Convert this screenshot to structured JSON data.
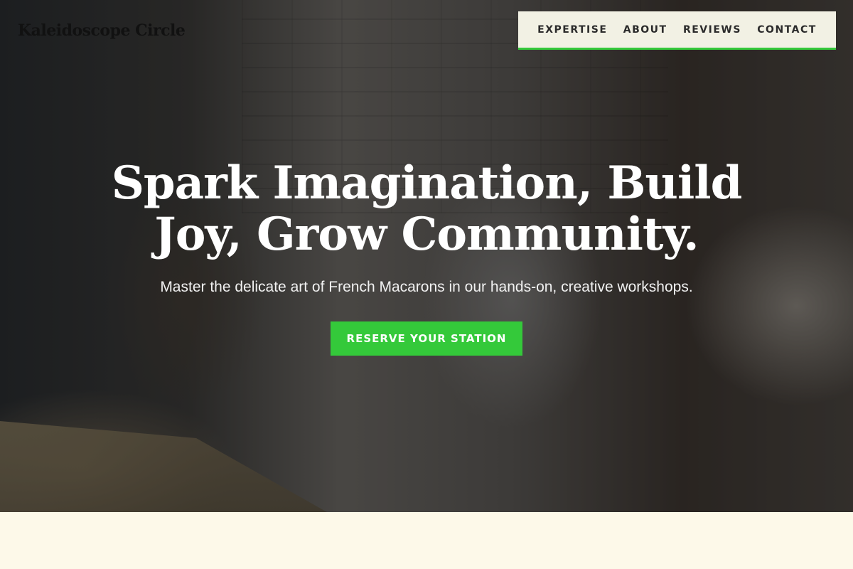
{
  "brand": {
    "name": "Kaleidoscope Circle"
  },
  "nav": {
    "items": [
      {
        "label": "EXPERTISE"
      },
      {
        "label": "ABOUT"
      },
      {
        "label": "REVIEWS"
      },
      {
        "label": "CONTACT"
      }
    ]
  },
  "hero": {
    "headline": "Spark Imagination, Build Joy, Grow Community.",
    "subheadline": "Master the delicate art of French Macarons in our hands-on, creative workshops.",
    "cta_label": "RESERVE YOUR STATION"
  },
  "colors": {
    "accent": "#34c93a",
    "nav_background": "#f2f1e4",
    "page_background": "#fdf9e9"
  }
}
